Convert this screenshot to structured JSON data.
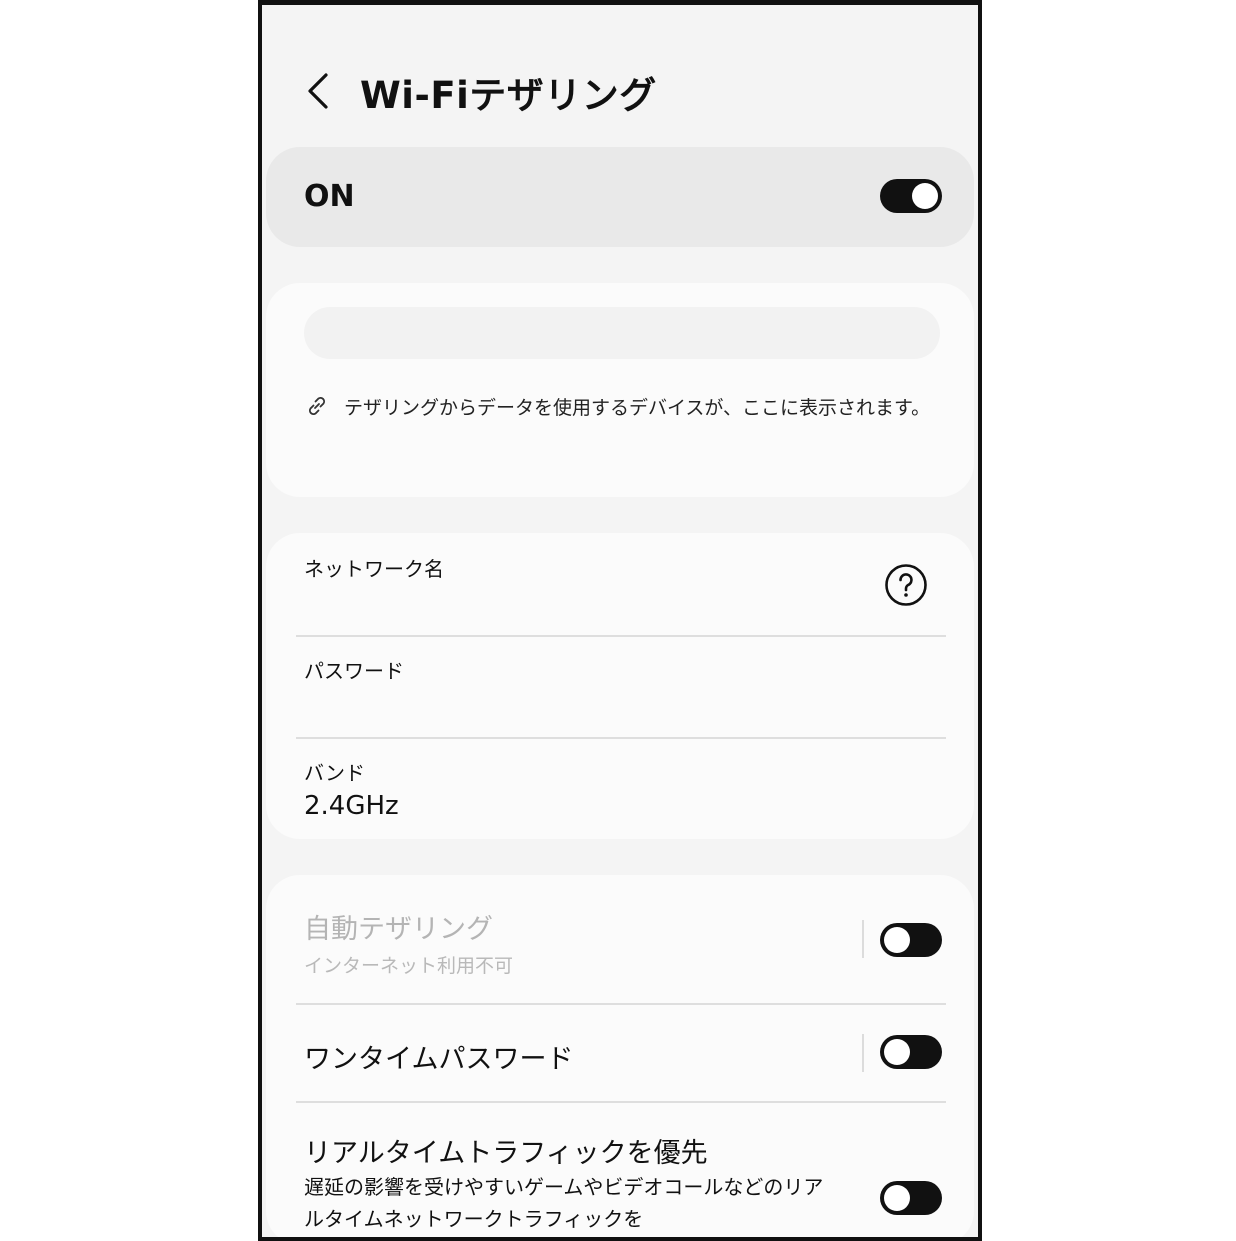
{
  "header": {
    "title": "Wi-Fiテザリング",
    "back_icon": "chevron-left-icon"
  },
  "master_switch": {
    "label": "ON",
    "state": "on"
  },
  "devices": {
    "message": "テザリングからデータを使用するデバイスが、ここに表示されます。",
    "icon": "link-icon"
  },
  "network": {
    "name_label": "ネットワーク名",
    "password_label": "パスワード",
    "band_label": "バンド",
    "band_value": "2.4GHz",
    "help_icon": "help-circle-icon"
  },
  "options": [
    {
      "title": "自動テザリング",
      "subtitle": "インターネット利用不可",
      "enabled": false,
      "state": "off"
    },
    {
      "title": "ワンタイムパスワード",
      "state": "off"
    },
    {
      "title": "リアルタイムトラフィックを優先",
      "description": "遅延の影響を受けやすいゲームやビデオコールなどのリアルタイムネットワークトラフィックを",
      "state": "off"
    }
  ],
  "colors": {
    "toggle": "#111111",
    "card": "#fbfbfb",
    "background": "#f4f4f4",
    "master_card": "#e9e9e9"
  }
}
